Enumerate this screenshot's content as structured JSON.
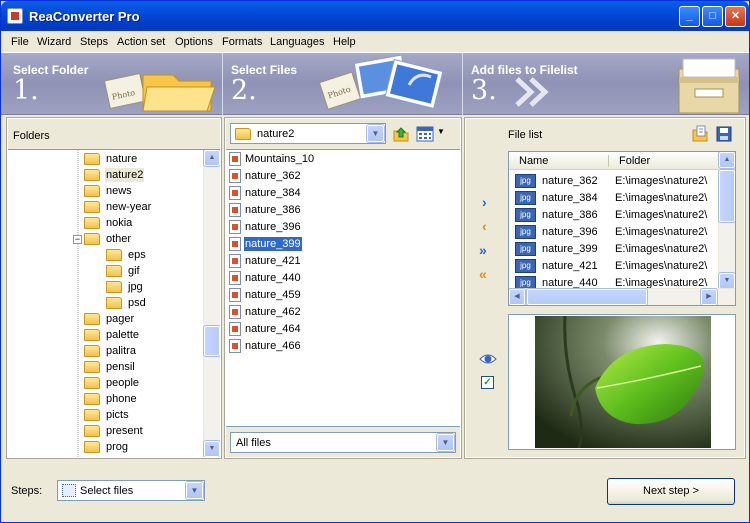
{
  "window": {
    "title": "ReaConverter Pro"
  },
  "menu": [
    "File",
    "Wizard",
    "Steps",
    "Action set",
    "Options",
    "Formats",
    "Languages",
    "Help"
  ],
  "steps": [
    {
      "label": "Select Folder",
      "number": "1."
    },
    {
      "label": "Select Files",
      "number": "2."
    },
    {
      "label": "Add files to Filelist",
      "number": "3."
    }
  ],
  "art": {
    "photo_text": "Photo"
  },
  "folders_panel": {
    "label": "Folders",
    "tree": [
      {
        "name": "nature",
        "level": 0
      },
      {
        "name": "nature2",
        "level": 0,
        "selected": true
      },
      {
        "name": "news",
        "level": 0
      },
      {
        "name": "new-year",
        "level": 0
      },
      {
        "name": "nokia",
        "level": 0
      },
      {
        "name": "other",
        "level": 0,
        "expanded": true
      },
      {
        "name": "eps",
        "level": 1
      },
      {
        "name": "gif",
        "level": 1
      },
      {
        "name": "jpg",
        "level": 1
      },
      {
        "name": "psd",
        "level": 1
      },
      {
        "name": "pager",
        "level": 0
      },
      {
        "name": "palette",
        "level": 0
      },
      {
        "name": "palitra",
        "level": 0
      },
      {
        "name": "pensil",
        "level": 0
      },
      {
        "name": "people",
        "level": 0
      },
      {
        "name": "phone",
        "level": 0
      },
      {
        "name": "picts",
        "level": 0
      },
      {
        "name": "present",
        "level": 0
      },
      {
        "name": "prog",
        "level": 0
      }
    ]
  },
  "files_panel": {
    "folder_combo": "nature2",
    "files": [
      "Mountains_10",
      "nature_362",
      "nature_384",
      "nature_386",
      "nature_396",
      "nature_399",
      "nature_421",
      "nature_440",
      "nature_459",
      "nature_462",
      "nature_464",
      "nature_466"
    ],
    "selected_file": "nature_399",
    "filter": "All files"
  },
  "filelist_panel": {
    "label": "File list",
    "columns": [
      "Name",
      "Folder"
    ],
    "rows": [
      {
        "type": "jpg",
        "name": "nature_362",
        "folder": "E:\\images\\nature2\\"
      },
      {
        "type": "jpg",
        "name": "nature_384",
        "folder": "E:\\images\\nature2\\"
      },
      {
        "type": "jpg",
        "name": "nature_386",
        "folder": "E:\\images\\nature2\\"
      },
      {
        "type": "jpg",
        "name": "nature_396",
        "folder": "E:\\images\\nature2\\"
      },
      {
        "type": "jpg",
        "name": "nature_399",
        "folder": "E:\\images\\nature2\\"
      },
      {
        "type": "jpg",
        "name": "nature_421",
        "folder": "E:\\images\\nature2\\"
      },
      {
        "type": "jpg",
        "name": "nature_440",
        "folder": "E:\\images\\nature2\\"
      }
    ]
  },
  "footer": {
    "steps_label": "Steps:",
    "steps_value": "Select files",
    "next_label": "Next step >"
  },
  "colors": {
    "selection": "#316ac5",
    "title_bar": "#0347d6",
    "arrow_blue": "#2d63d6",
    "arrow_orange": "#e38a1c"
  }
}
